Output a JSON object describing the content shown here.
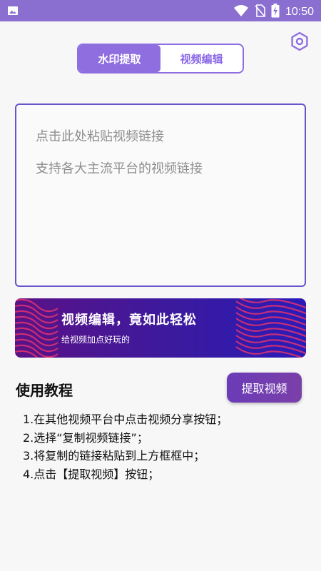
{
  "status_bar": {
    "time": "10:50",
    "icons": [
      "image-icon",
      "wifi-icon",
      "no-sim-icon",
      "battery-charging-icon"
    ]
  },
  "header": {
    "settings_icon": "hexagon-settings-icon"
  },
  "tabs": [
    {
      "label": "水印提取",
      "active": true
    },
    {
      "label": "视频编辑",
      "active": false
    }
  ],
  "link_input": {
    "placeholder_line1": "点击此处粘贴视频链接",
    "placeholder_line2": "支持各大主流平台的视频链接"
  },
  "banner": {
    "title": "视频编辑，竟如此轻松",
    "subtitle": "给视频加点好玩的"
  },
  "tutorial": {
    "title": "使用教程",
    "extract_button": "提取视频",
    "steps": [
      "1.在其他视频平台中点击视频分享按钮；",
      "2.选择“复制视频链接”；",
      "3.将复制的链接粘贴到上方框框中；",
      "4.点击【提取视频】按钮；"
    ]
  },
  "colors": {
    "accent": "#8f6fe0",
    "status_bar": "#8a6fd0",
    "border": "#6a54c8",
    "button": "#6a3cb7"
  }
}
